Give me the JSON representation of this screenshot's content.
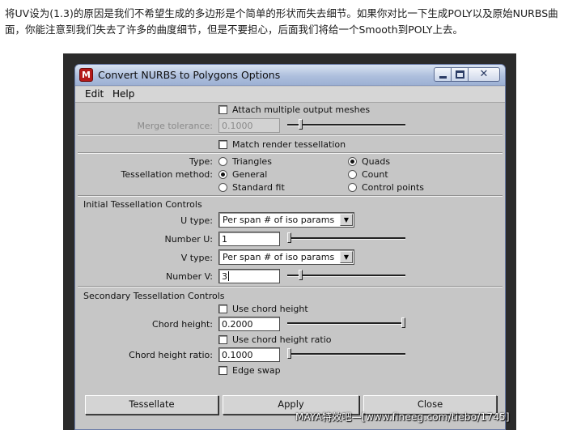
{
  "article": {
    "intro_text": "将UV设为(1.3)的原因是我们不希望生成的多边形是个简单的形状而失去细节。如果你对比一下生成POLY以及原始NURBS曲面，你能注意到我们失去了许多的曲度细节，但是不要担心，后面我们将给一个Smooth到POLY上去。"
  },
  "window": {
    "title": "Convert NURBS to Polygons Options",
    "app_icon": "maya-icon",
    "controls": [
      "minimize-icon",
      "maximize-icon",
      "close-icon"
    ]
  },
  "menubar": {
    "items": [
      "Edit",
      "Help"
    ]
  },
  "options": {
    "attach_multiple_label": "Attach multiple output meshes",
    "attach_multiple_checked": false,
    "merge_tolerance_label": "Merge tolerance:",
    "merge_tolerance_value": "0.1000",
    "merge_tolerance_slider_fraction": 0.1,
    "match_render_label": "Match render tessellation",
    "match_render_checked": false,
    "type_label": "Type:",
    "type_options": [
      "Triangles",
      "Quads"
    ],
    "type_selected": "Quads",
    "method_label": "Tessellation method:",
    "method_options": [
      "General",
      "Count",
      "Standard fit",
      "Control points"
    ],
    "method_selected": "General"
  },
  "initial_controls": {
    "title": "Initial Tessellation Controls",
    "u_type_label": "U type:",
    "u_type_value": "Per span # of iso params",
    "number_u_label": "Number U:",
    "number_u_value": "1",
    "number_u_slider_fraction": 0.0,
    "v_type_label": "V type:",
    "v_type_value": "Per span # of iso params",
    "number_v_label": "Number V:",
    "number_v_value": "3",
    "number_v_slider_fraction": 0.1
  },
  "secondary_controls": {
    "title": "Secondary Tessellation Controls",
    "use_chord_height_label": "Use chord height",
    "use_chord_height_checked": false,
    "chord_height_label": "Chord height:",
    "chord_height_value": "0.2000",
    "chord_height_slider_fraction": 1.0,
    "use_chord_ratio_label": "Use chord height ratio",
    "use_chord_ratio_checked": false,
    "chord_ratio_label": "Chord height ratio:",
    "chord_ratio_value": "0.1000",
    "chord_ratio_slider_fraction": 0.0,
    "edge_swap_label": "Edge swap",
    "edge_swap_checked": false
  },
  "buttons": {
    "tessellate": "Tessellate",
    "apply": "Apply",
    "close": "Close"
  },
  "watermark": "MAYA特效吧—[www.fineeg.com/tiebo/1745]"
}
